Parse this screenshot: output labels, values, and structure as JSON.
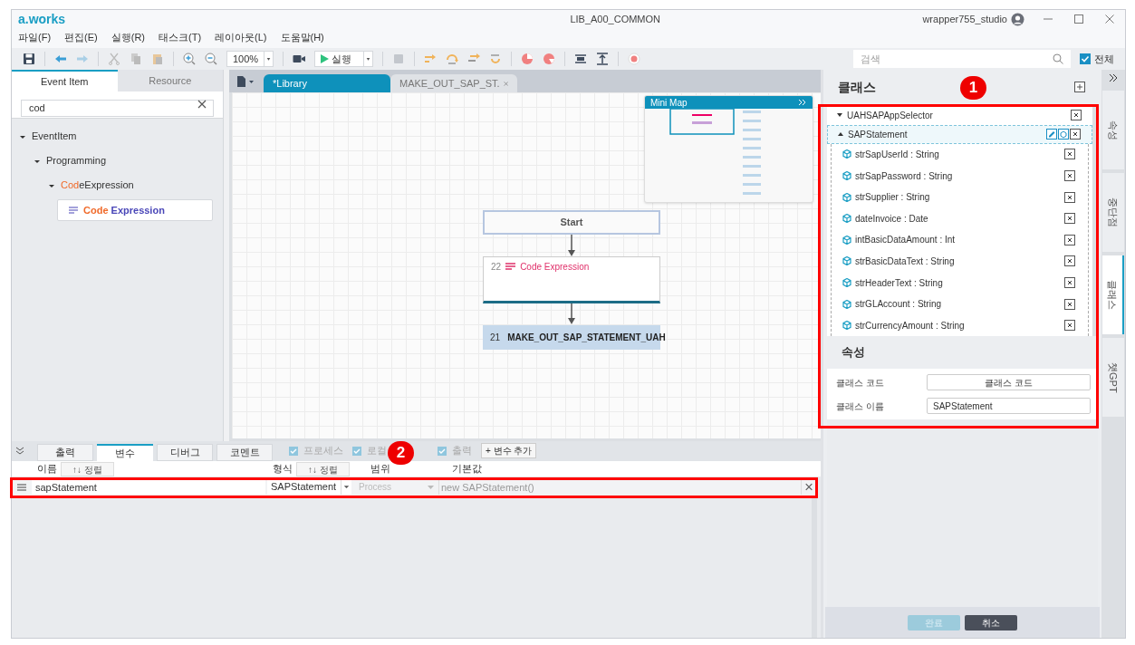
{
  "window": {
    "logo": "a.works",
    "title": "LIB_A00_COMMON",
    "user": "wrapper755_studio"
  },
  "menu": [
    "파일(F)",
    "편집(E)",
    "실행(R)",
    "태스크(T)",
    "레이아웃(L)",
    "도움말(H)"
  ],
  "toolbar": {
    "zoom": "100%",
    "run": "실행",
    "search_placeholder": "검색",
    "all_checkbox": {
      "label": "전체",
      "checked": true
    }
  },
  "left_panel": {
    "tabs": [
      {
        "label": "Event Item",
        "selected": true
      },
      {
        "label": "Resource",
        "selected": false
      }
    ],
    "search_value": "cod",
    "tree": [
      {
        "rest": "EventItem",
        "expanded": true,
        "selected": false,
        "children": [
          {
            "rest": "Programming",
            "expanded": true,
            "selected": false,
            "children": [
              {
                "match": "Cod",
                "rest": "eExpression",
                "expanded": true,
                "selected": false,
                "children": [
                  {
                    "match": "Code",
                    "rest": " Expression",
                    "selected": true
                  }
                ]
              }
            ]
          }
        ]
      }
    ]
  },
  "doc_tabs": [
    {
      "label": "*Library",
      "selected": true,
      "closable": false
    },
    {
      "label": "MAKE_OUT_SAP_ST.",
      "selected": false,
      "closable": true
    }
  ],
  "minimap": {
    "title": "Mini Map"
  },
  "flow": [
    {
      "kind": "start",
      "label": "Start"
    },
    {
      "kind": "code",
      "number": "22",
      "label": "Code Expression"
    },
    {
      "kind": "sub",
      "number": "21",
      "label": "MAKE_OUT_SAP_STATEMENT_UAH"
    }
  ],
  "bottom_panel": {
    "tabs": [
      {
        "label": "출력",
        "selected": false
      },
      {
        "label": "변수",
        "selected": true
      },
      {
        "label": "디버그",
        "selected": false
      },
      {
        "label": "코멘트",
        "selected": false
      }
    ],
    "filters": [
      {
        "label": "프로세스",
        "checked": true
      },
      {
        "label": "로컬",
        "checked": true
      },
      {
        "label": "출력",
        "checked": true
      }
    ],
    "add_button": "+ 변수 추가",
    "columns": [
      {
        "label": "이름",
        "sort": "↑↓ 정렬"
      },
      {
        "label": "형식",
        "sort": "↑↓ 정렬"
      },
      {
        "label": "범위"
      },
      {
        "label": "기본값"
      }
    ],
    "rows": [
      {
        "name": "sapStatement",
        "type": "SAPStatement",
        "scope": "Process",
        "default_placeholder": "new SAPStatement()"
      }
    ]
  },
  "class_panel": {
    "title": "클래스",
    "classes": [
      {
        "name": "UAHSAPAppSelector",
        "expanded": false,
        "selected": false
      },
      {
        "name": "SAPStatement",
        "expanded": true,
        "selected": true,
        "fields": [
          "strSapUserId : String",
          "strSapPassword : String",
          "strSupplier : String",
          "dateInvoice : Date",
          "intBasicDataAmount : Int",
          "strBasicDataText : String",
          "strHeaderText : String",
          "strGLAccount : String",
          "strCurrencyAmount : String"
        ]
      }
    ],
    "properties_title": "속성",
    "properties": [
      {
        "label": "클래스 코드",
        "placeholder": "클래스 코드"
      },
      {
        "label": "클래스 이름",
        "value": "SAPStatement"
      }
    ],
    "buttons": [
      {
        "label": "완료",
        "disabled": true
      },
      {
        "label": "취소",
        "disabled": false
      }
    ]
  },
  "side_tabs": [
    {
      "label": "속성",
      "selected": false
    },
    {
      "label": "중단점",
      "selected": false
    },
    {
      "label": "클래스",
      "selected": true
    },
    {
      "label": "챗GPT",
      "selected": false
    }
  ],
  "annotations": [
    {
      "number": "1"
    },
    {
      "number": "2"
    }
  ]
}
